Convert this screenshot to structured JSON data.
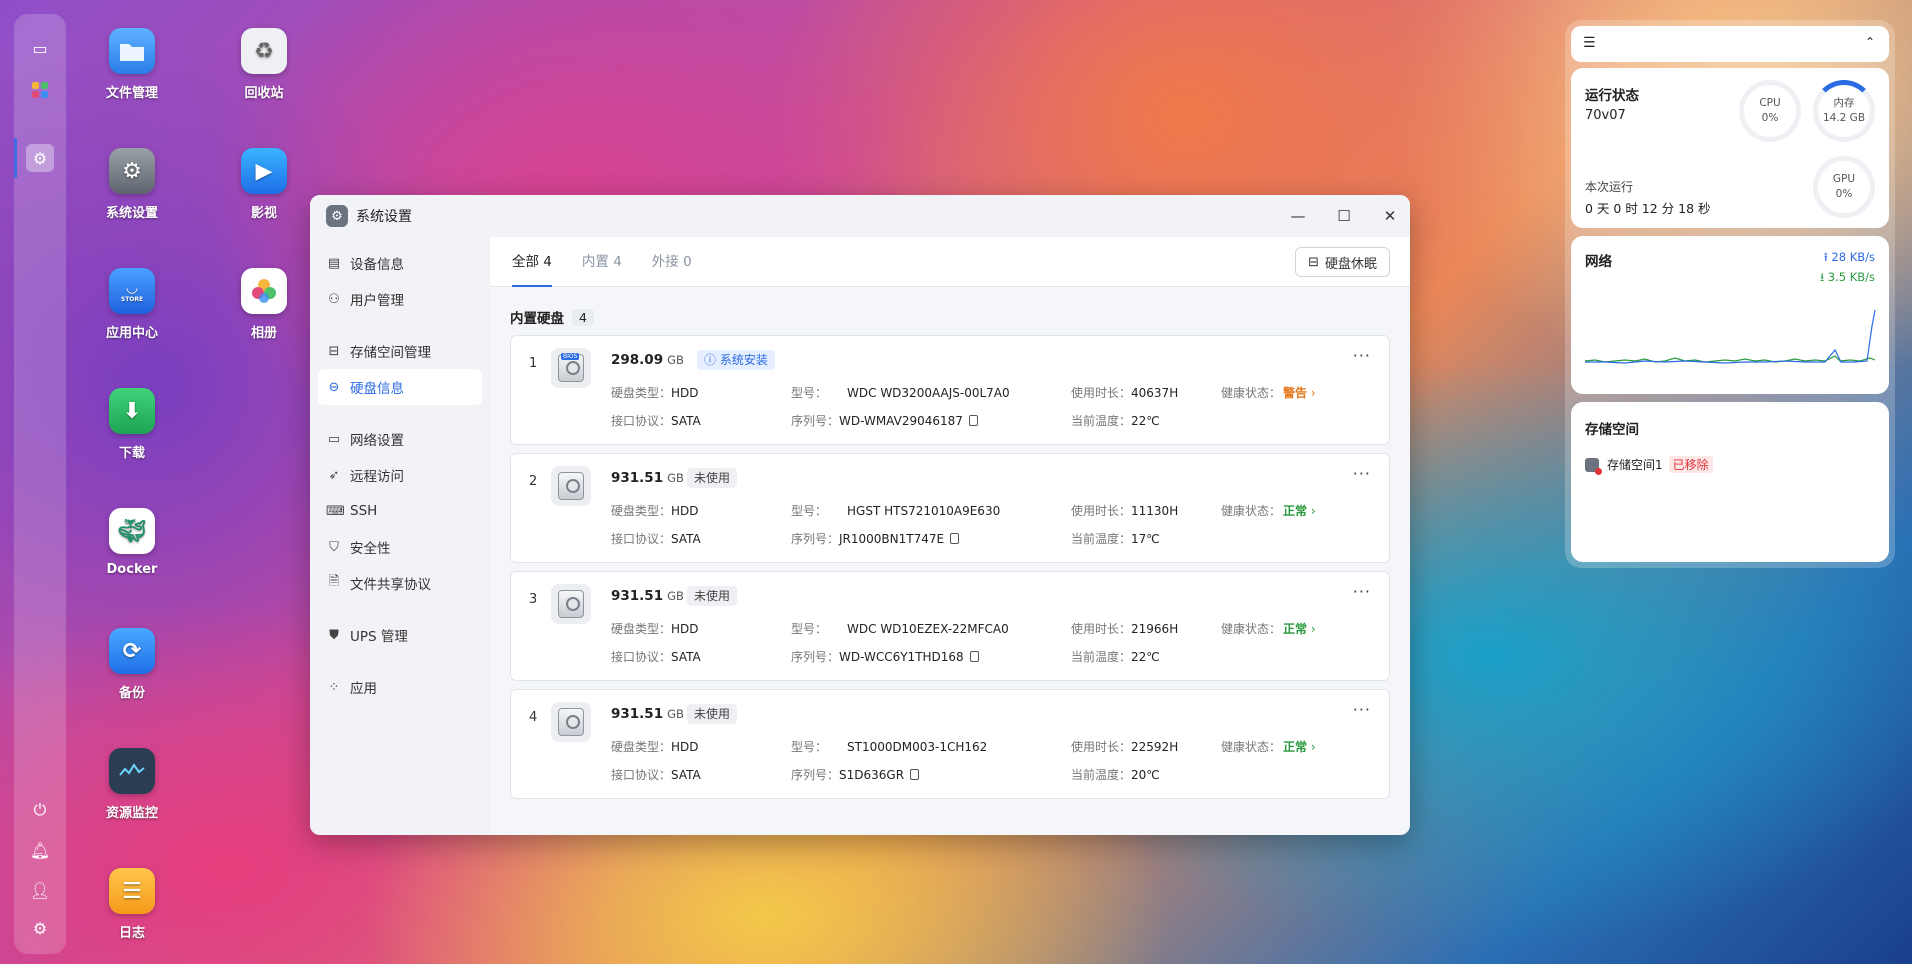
{
  "desktop": {
    "icons": [
      {
        "label": "文件管理",
        "icon": "folder-icon"
      },
      {
        "label": "回收站",
        "icon": "recycle-icon"
      },
      {
        "label": "系统设置",
        "icon": "gear-icon"
      },
      {
        "label": "影视",
        "icon": "video-icon"
      },
      {
        "label": "应用中心",
        "icon": "store-icon",
        "sub": "STORE"
      },
      {
        "label": "相册",
        "icon": "photo-icon"
      },
      {
        "label": "下载",
        "icon": "download-icon"
      },
      {
        "label": "Docker",
        "icon": "docker-icon"
      },
      {
        "label": "备份",
        "icon": "backup-icon"
      },
      {
        "label": "资源监控",
        "icon": "monitor-icon"
      },
      {
        "label": "日志",
        "icon": "log-icon"
      }
    ]
  },
  "window": {
    "title": "系统设置",
    "sidebar": [
      {
        "label": "设备信息",
        "icon": "device-icon"
      },
      {
        "label": "用户管理",
        "icon": "user-icon"
      },
      {
        "label": "存储空间管理",
        "icon": "storage-icon"
      },
      {
        "label": "硬盘信息",
        "icon": "disk-icon"
      },
      {
        "label": "网络设置",
        "icon": "network-icon"
      },
      {
        "label": "远程访问",
        "icon": "remote-icon"
      },
      {
        "label": "SSH",
        "icon": "ssh-icon"
      },
      {
        "label": "安全性",
        "icon": "shield-icon"
      },
      {
        "label": "文件共享协议",
        "icon": "file-share-icon"
      },
      {
        "label": "UPS 管理",
        "icon": "ups-icon"
      },
      {
        "label": "应用",
        "icon": "apps-icon"
      }
    ],
    "tabs": [
      {
        "label": "全部",
        "count": "4"
      },
      {
        "label": "内置",
        "count": "4"
      },
      {
        "label": "外接",
        "count": "0"
      }
    ],
    "sleep_button": "硬盘休眠",
    "section_title": "内置硬盘",
    "section_count": "4",
    "labels": {
      "type": "硬盘类型：",
      "protocol": "接口协议：",
      "model": "型号：",
      "serial": "序列号：",
      "usage": "使用时长：",
      "temp": "当前温度：",
      "health": "健康状态："
    },
    "disks": [
      {
        "index": "1",
        "size": "298.09",
        "unit": "GB",
        "badge": "系统安装",
        "bios": "BIOS",
        "type": "HDD",
        "protocol": "SATA",
        "model": "WDC WD3200AAJS-00L7A0",
        "serial": "WD-WMAV29046187",
        "usage": "40637H",
        "temp": "22℃",
        "health": "警告"
      },
      {
        "index": "2",
        "size": "931.51",
        "unit": "GB",
        "badge": "未使用",
        "type": "HDD",
        "protocol": "SATA",
        "model": "HGST HTS721010A9E630",
        "serial": "JR1000BN1T747E",
        "usage": "11130H",
        "temp": "17℃",
        "health": "正常"
      },
      {
        "index": "3",
        "size": "931.51",
        "unit": "GB",
        "badge": "未使用",
        "type": "HDD",
        "protocol": "SATA",
        "model": "WDC WD10EZEX-22MFCA0",
        "serial": "WD-WCC6Y1THD168",
        "usage": "21966H",
        "temp": "22℃",
        "health": "正常"
      },
      {
        "index": "4",
        "size": "931.51",
        "unit": "GB",
        "badge": "未使用",
        "type": "HDD",
        "protocol": "SATA",
        "model": "ST1000DM003-1CH162",
        "serial": "S1D636GR",
        "usage": "22592H",
        "temp": "20℃",
        "health": "正常"
      }
    ]
  },
  "widgets": {
    "status_title": "运行状态",
    "device_name": "70v07",
    "uptime_label": "本次运行",
    "uptime": "0 天 0 时 12 分 18 秒",
    "cpu": {
      "label": "CPU",
      "value": "0%"
    },
    "memory": {
      "label": "内存",
      "value": "14.2 GB"
    },
    "gpu": {
      "label": "GPU",
      "value": "0%"
    },
    "network_title": "网络",
    "upload": "28 KB/s",
    "download": "3.5 KB/s",
    "storage_title": "存储空间",
    "storage_item": "存储空间1",
    "storage_status": "已移除"
  },
  "colors": {
    "accent": "#2b6be3",
    "warn": "#e5781b",
    "ok": "#2a9a3f",
    "removed": "#e0333a"
  }
}
